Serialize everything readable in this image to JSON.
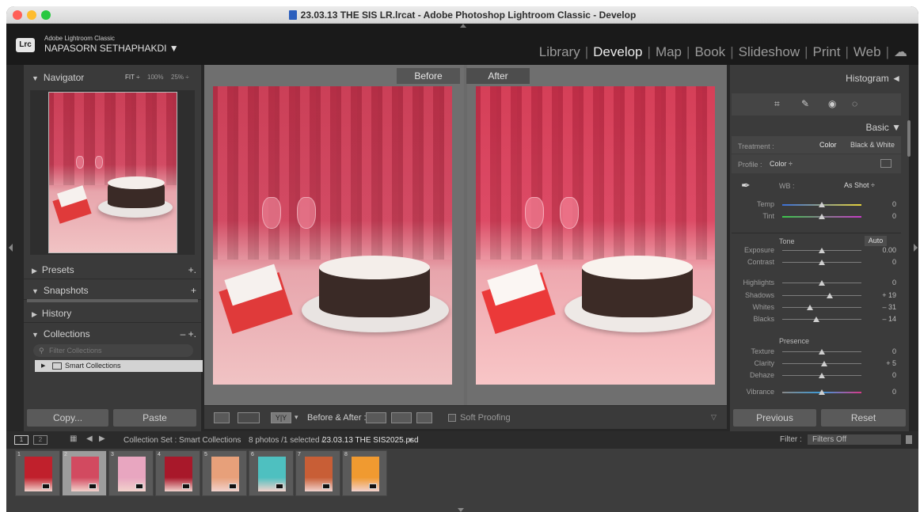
{
  "window": {
    "title": "23.03.13 THE SIS LR.lrcat - Adobe Photoshop Lightroom Classic - Develop",
    "traffic_colors": [
      "#ff5f57",
      "#febc2e",
      "#28c840"
    ]
  },
  "identity": {
    "logo": "Lrc",
    "product": "Adobe Lightroom Classic",
    "user": "NAPASORN SETHAPHAKDI ▼"
  },
  "modules": [
    {
      "label": "Library",
      "active": false
    },
    {
      "label": "Develop",
      "active": true
    },
    {
      "label": "Map",
      "active": false
    },
    {
      "label": "Book",
      "active": false
    },
    {
      "label": "Slideshow",
      "active": false
    },
    {
      "label": "Print",
      "active": false
    },
    {
      "label": "Web",
      "active": false
    }
  ],
  "navigator": {
    "title": "Navigator",
    "zoom_fit": "FIT ÷",
    "zoom_100": "100%",
    "zoom_25": "25% ÷"
  },
  "left_panels": {
    "presets": "Presets",
    "snapshots": "Snapshots",
    "history": "History",
    "collections": "Collections",
    "filter_placeholder": "Filter Collections",
    "smart_collections": "Smart Collections",
    "copy": "Copy...",
    "paste": "Paste"
  },
  "compare": {
    "before": "Before",
    "after": "After",
    "toolbar_label": "Before & After :",
    "soft_proofing": "Soft Proofing",
    "yy": "Y|Y"
  },
  "right_panel": {
    "histogram": "Histogram ◄",
    "basic": "Basic ▼",
    "treatment_label": "Treatment :",
    "treatment_color": "Color",
    "treatment_bw": "Black & White",
    "profile_label": "Profile :",
    "profile_value": "Color ÷",
    "wb_label": "WB :",
    "wb_value": "As Shot ÷",
    "tone": "Tone",
    "auto": "Auto",
    "presence": "Presence",
    "previous": "Previous",
    "reset": "Reset",
    "sliders": [
      {
        "label": "Temp",
        "value": "0",
        "pos": 0.5,
        "group": "wb",
        "color": "temp"
      },
      {
        "label": "Tint",
        "value": "0",
        "pos": 0.5,
        "group": "wb",
        "color": "tint"
      },
      {
        "label": "Exposure",
        "value": "0.00",
        "pos": 0.5,
        "group": "tone"
      },
      {
        "label": "Contrast",
        "value": "0",
        "pos": 0.5,
        "group": "tone"
      },
      {
        "label": "Highlights",
        "value": "0",
        "pos": 0.5,
        "group": "tone"
      },
      {
        "label": "Shadows",
        "value": "+ 19",
        "pos": 0.595,
        "group": "tone"
      },
      {
        "label": "Whites",
        "value": "– 31",
        "pos": 0.345,
        "group": "tone"
      },
      {
        "label": "Blacks",
        "value": "– 14",
        "pos": 0.43,
        "group": "tone"
      },
      {
        "label": "Texture",
        "value": "0",
        "pos": 0.5,
        "group": "presence"
      },
      {
        "label": "Clarity",
        "value": "+ 5",
        "pos": 0.525,
        "group": "presence"
      },
      {
        "label": "Dehaze",
        "value": "0",
        "pos": 0.5,
        "group": "presence"
      },
      {
        "label": "Vibrance",
        "value": "0",
        "pos": 0.5,
        "group": "presence",
        "color": "vib"
      }
    ]
  },
  "filmstrip_bar": {
    "page1": "1",
    "page2": "2",
    "source": "Collection Set : Smart Collections",
    "count": "8 photos /1 selected /",
    "file": "23.03.13 THE SIS2025.psd",
    "file_arrow": "▾",
    "filter_label": "Filter :",
    "filter_value": "Filters Off"
  },
  "filmstrip": [
    {
      "num": "1",
      "color": "#c0202c",
      "selected": false
    },
    {
      "num": "2",
      "color": "#d24a60",
      "selected": true
    },
    {
      "num": "3",
      "color": "#e8a6c0",
      "selected": false
    },
    {
      "num": "4",
      "color": "#a8182a",
      "selected": false
    },
    {
      "num": "5",
      "color": "#e7a07a",
      "selected": false
    },
    {
      "num": "6",
      "color": "#4ec0c0",
      "selected": false
    },
    {
      "num": "7",
      "color": "#c85e36",
      "selected": false
    },
    {
      "num": "8",
      "color": "#f09a30",
      "selected": false
    }
  ]
}
